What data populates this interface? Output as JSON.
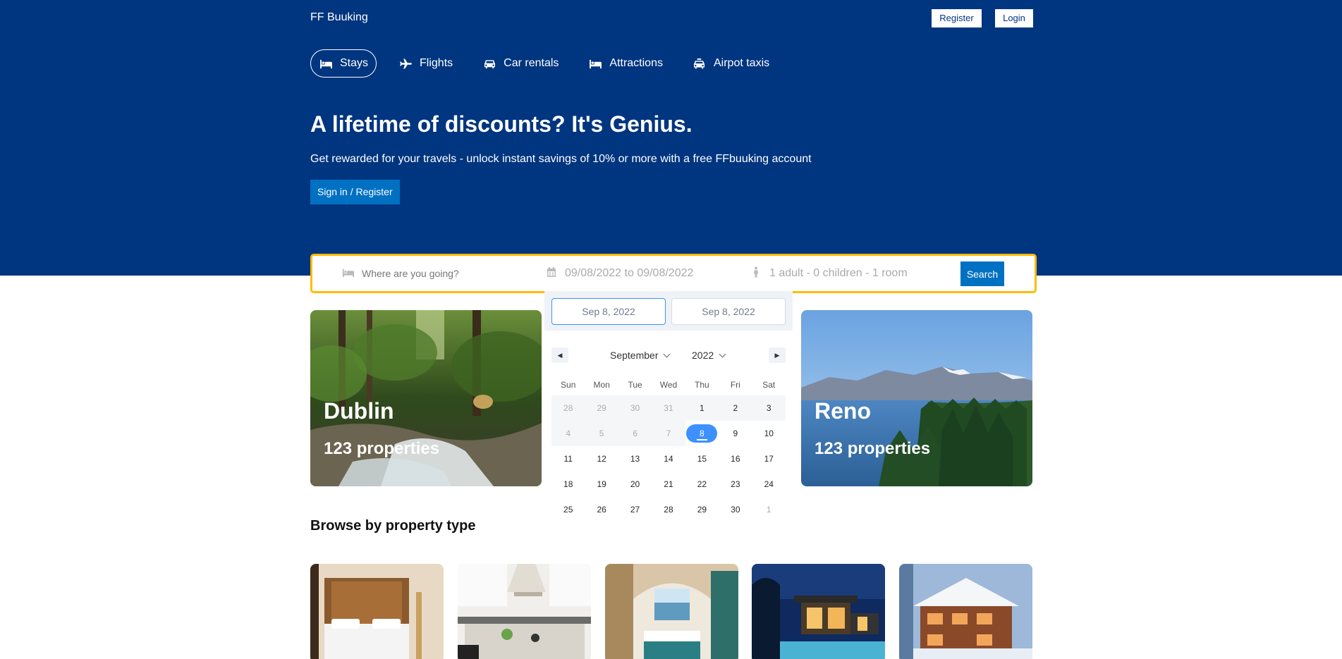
{
  "header": {
    "logo": "FF Buuking",
    "register_label": "Register",
    "login_label": "Login"
  },
  "nav": {
    "items": [
      {
        "label": "Stays",
        "icon": "bed-icon",
        "active": true
      },
      {
        "label": "Flights",
        "icon": "plane-icon"
      },
      {
        "label": "Car rentals",
        "icon": "car-icon"
      },
      {
        "label": "Attractions",
        "icon": "bed-icon"
      },
      {
        "label": "Airpot taxis",
        "icon": "taxi-icon"
      }
    ]
  },
  "hero": {
    "title": "A lifetime of discounts? It's Genius.",
    "subtitle": "Get rewarded for your travels - unlock instant savings of 10% or more with a free FFbuuking account",
    "cta_label": "Sign in / Register"
  },
  "search": {
    "destination_placeholder": "Where are you going?",
    "date_range": "09/08/2022 to 09/08/2022",
    "guests": "1 adult - 0 children - 1 room",
    "button_label": "Search"
  },
  "calendar": {
    "start_date": "Sep 8, 2022",
    "end_date": "Sep 8, 2022",
    "month": "September",
    "year": "2022",
    "weekdays": [
      "Sun",
      "Mon",
      "Tue",
      "Wed",
      "Thu",
      "Fri",
      "Sat"
    ],
    "weeks": [
      [
        "28",
        "29",
        "30",
        "31",
        "1",
        "2",
        "3"
      ],
      [
        "4",
        "5",
        "6",
        "7",
        "8",
        "9",
        "10"
      ],
      [
        "11",
        "12",
        "13",
        "14",
        "15",
        "16",
        "17"
      ],
      [
        "18",
        "19",
        "20",
        "21",
        "22",
        "23",
        "24"
      ],
      [
        "25",
        "26",
        "27",
        "28",
        "29",
        "30",
        "1"
      ]
    ],
    "selected_day": "8"
  },
  "cities": [
    {
      "name": "Dublin",
      "count": "123 properties"
    },
    {
      "name": "Reno",
      "count": "123 properties"
    }
  ],
  "browse": {
    "title": "Browse by property type"
  },
  "colors": {
    "brand": "#003580",
    "accent": "#0071c2",
    "search_border": "#febb02",
    "date_highlight": "#3d91ff"
  }
}
